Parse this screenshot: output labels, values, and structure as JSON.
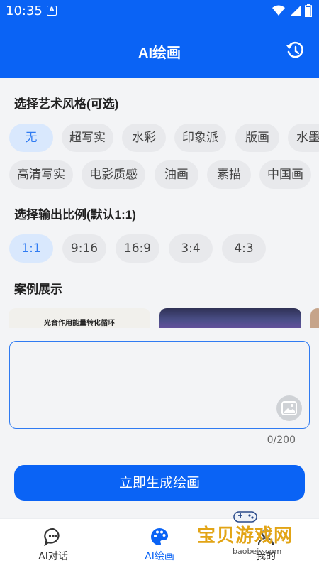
{
  "status_bar": {
    "time": "10:35",
    "notification_glyph": "A"
  },
  "header": {
    "title": "AI绘画",
    "history_icon": "history-icon"
  },
  "style_section": {
    "title": "选择艺术风格(可选)",
    "row1": [
      "无",
      "超写实",
      "水彩",
      "印象派",
      "版画",
      "水墨"
    ],
    "row2": [
      "高清写实",
      "电影质感",
      "油画",
      "素描",
      "中国画"
    ],
    "selected": "无"
  },
  "ratio_section": {
    "title": "选择输出比例(默认1:1)",
    "options": [
      "1:1",
      "9:16",
      "16:9",
      "3:4",
      "4:3"
    ],
    "selected": "1:1"
  },
  "cases_section": {
    "title": "案例展示",
    "card1_caption": "光合作用能量转化循环"
  },
  "prompt": {
    "value": "",
    "placeholder": "",
    "counter": "0/200"
  },
  "generate_button": {
    "label": "立即生成绘画"
  },
  "tabbar": {
    "tabs": [
      {
        "label": "AI对话",
        "icon": "chat-icon"
      },
      {
        "label": "AI绘画",
        "icon": "palette-icon",
        "active": true
      },
      {
        "label": "我的",
        "icon": "user-icon"
      }
    ]
  },
  "watermark": {
    "text": "宝贝游戏网",
    "url": "baobeiy.com"
  },
  "colors": {
    "primary": "#0a63f5",
    "chip_active_bg": "#d9e8fd",
    "chip_active_text": "#2f7bf2",
    "chip_bg": "#e8e9ec"
  }
}
